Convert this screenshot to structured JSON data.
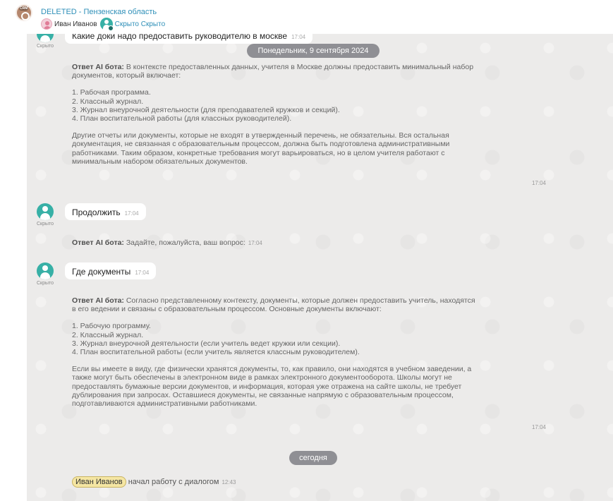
{
  "header": {
    "title": "DELETED - Пензенская область",
    "user_name": "Иван Иванов",
    "hidden_label": "Скрыто Скрыто",
    "logo_icon": "crm-logo-icon"
  },
  "chat": {
    "date_divider": "Понедельник, 9 сентября 2024",
    "today_divider": "сегодня",
    "avatar_label": "Скрыто",
    "user_messages": [
      {
        "text": "Какие доки надо предоставить руководителю в москве",
        "time": "17:04"
      },
      {
        "text": "Продолжить",
        "time": "17:04"
      },
      {
        "text": "Где документы",
        "time": "17:04"
      }
    ],
    "bot_prefix": "Ответ AI бота:",
    "bot_1": {
      "l1": " В контексте предоставленных данных, учителя в Москве должны предоставить минимальный набор",
      "l2": "документов, который включает:",
      "i1": "1. Рабочая программа.",
      "i2": "2. Классный журнал.",
      "i3": "3. Журнал внеурочной деятельности (для преподавателей кружков и секций).",
      "i4": "4. План воспитательной работы (для классных руководителей).",
      "p1": "Другие отчеты или документы, которые не входят в утвержденный перечень, не обязательны. Вся остальная",
      "p2": "документация, не связанная с образовательным процессом, должна быть подготовлена административными",
      "p3": "работниками. Таким образом, конкретные требования могут варьироваться, но в целом учителя работают с",
      "p4": "минимальным набором обязательных документов.",
      "time": "17:04"
    },
    "bot_2": {
      "text": " Задайте, пожалуйста, ваш вопрос:",
      "time": "17:04"
    },
    "bot_3": {
      "l1": " Согласно представленному контексту, документы, которые должен предоставить учитель, находятся",
      "l2": "в его ведении и связаны с образовательным процессом. Основные документы включают:",
      "i1": "1. Рабочую программу.",
      "i2": "2. Классный журнал.",
      "i3": "3. Журнал внеурочной деятельности (если учитель ведет кружки или секции).",
      "i4": "4. План воспитательной работы (если учитель является классным руководителем).",
      "p1": "Если вы имеете в виду, где физически хранятся документы, то, как правило, они находятся в учебном заведении, а",
      "p2": "также могут быть обеспечены в электронном виде в рамках электронного документооборота. Школы могут не",
      "p3": "предоставлять бумажные версии документов, и информация, которая уже отражена на сайте школы, не требует",
      "p4": "дублирования при запросах. Оставшиеся документы, не связанные напрямую с образовательным процессом,",
      "p5": "подготавливаются административными работниками.",
      "time": "17:04"
    },
    "joined": {
      "name": "Иван Иванов",
      "text": " начал работу с диалогом",
      "time": "12:43"
    }
  },
  "colors": {
    "chat_bg": "#ecebea",
    "accent": "#2e8fb8",
    "avatar": "#37b0a6",
    "pill": "#8f8f94"
  }
}
